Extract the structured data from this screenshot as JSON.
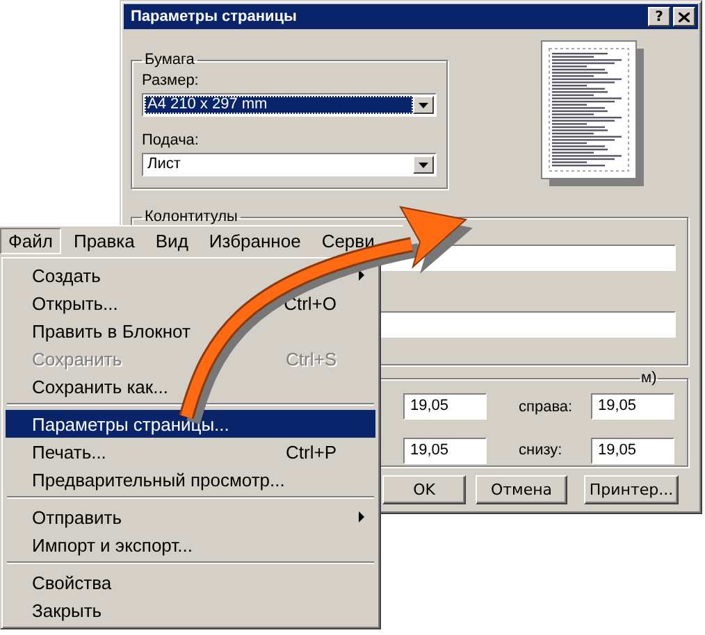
{
  "dialog": {
    "title": "Параметры страницы",
    "help": "?",
    "paper": {
      "legend": "Бумага",
      "size_label": "Размер:",
      "size_value": "A4 210 x 297 mm",
      "source_label": "Подача:",
      "source_value": "Лист"
    },
    "headers": {
      "legend": "Колонтитулы"
    },
    "margins": {
      "legend": "м)",
      "fields": [
        {
          "value": "19,05"
        },
        {
          "label": "справа:",
          "value": "19,05"
        },
        {
          "value": "19,05"
        },
        {
          "label": "снизу:",
          "value": "19,05"
        }
      ]
    },
    "buttons": [
      "OK",
      "Отмена",
      "Принтер..."
    ]
  },
  "menu_bar": [
    {
      "label": "Файл",
      "selected": true
    },
    {
      "label": "Правка",
      "selected": false
    },
    {
      "label": "Вид",
      "selected": false
    },
    {
      "label": "Избранное",
      "selected": false
    },
    {
      "label": "Серви",
      "selected": false
    }
  ],
  "menu": [
    {
      "kind": "item",
      "label": "Создать",
      "submenu": true,
      "disabled": false,
      "selected": false
    },
    {
      "kind": "item",
      "label": "Открыть...",
      "shortcut": "Ctrl+O",
      "submenu": false,
      "disabled": false,
      "selected": false
    },
    {
      "kind": "item",
      "label": "Править в Блокнот",
      "submenu": false,
      "disabled": false,
      "selected": false
    },
    {
      "kind": "item",
      "label": "Сохранить",
      "shortcut": "Ctrl+S",
      "submenu": false,
      "disabled": true,
      "selected": false
    },
    {
      "kind": "item",
      "label": "Сохранить как...",
      "submenu": false,
      "disabled": false,
      "selected": false
    },
    {
      "kind": "separator"
    },
    {
      "kind": "item",
      "label": "Параметры страницы...",
      "submenu": false,
      "disabled": false,
      "selected": true
    },
    {
      "kind": "item",
      "label": "Печать...",
      "shortcut": "Ctrl+P",
      "submenu": false,
      "disabled": false,
      "selected": false
    },
    {
      "kind": "item",
      "label": "Предварительный просмотр...",
      "submenu": false,
      "disabled": false,
      "selected": false
    },
    {
      "kind": "separator"
    },
    {
      "kind": "item",
      "label": "Отправить",
      "submenu": true,
      "disabled": false,
      "selected": false
    },
    {
      "kind": "item",
      "label": "Импорт и экспорт...",
      "submenu": false,
      "disabled": false,
      "selected": false
    },
    {
      "kind": "separator"
    },
    {
      "kind": "item",
      "label": "Свойства",
      "submenu": false,
      "disabled": false,
      "selected": false
    },
    {
      "kind": "item",
      "label": "Закрыть",
      "submenu": false,
      "disabled": false,
      "selected": false
    }
  ]
}
